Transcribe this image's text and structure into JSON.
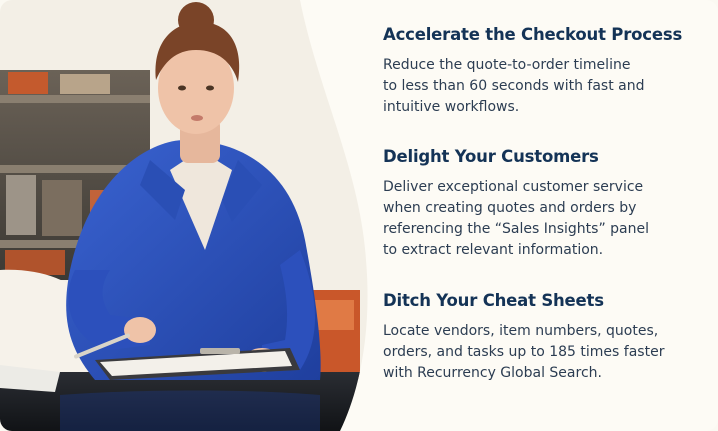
{
  "features": [
    {
      "title": "Accelerate the Checkout Process",
      "body": "Reduce the quote-to-order timeline\nto less than 60 seconds with fast and\nintuitive workflows."
    },
    {
      "title": "Delight Your Customers",
      "body": "Deliver exceptional customer service\nwhen creating quotes and orders by\nreferencing the “Sales Insights” panel\nto extract relevant information."
    },
    {
      "title": "Ditch Your Cheat Sheets",
      "body": "Locate vendors, item numbers, quotes,\norders, and tasks up to 185 times faster\nwith Recurrency Global Search."
    }
  ],
  "colors": {
    "heading": "#143356",
    "body_text": "#2c3d52",
    "background": "#fdfbf5",
    "coat": "#2f56c4"
  }
}
